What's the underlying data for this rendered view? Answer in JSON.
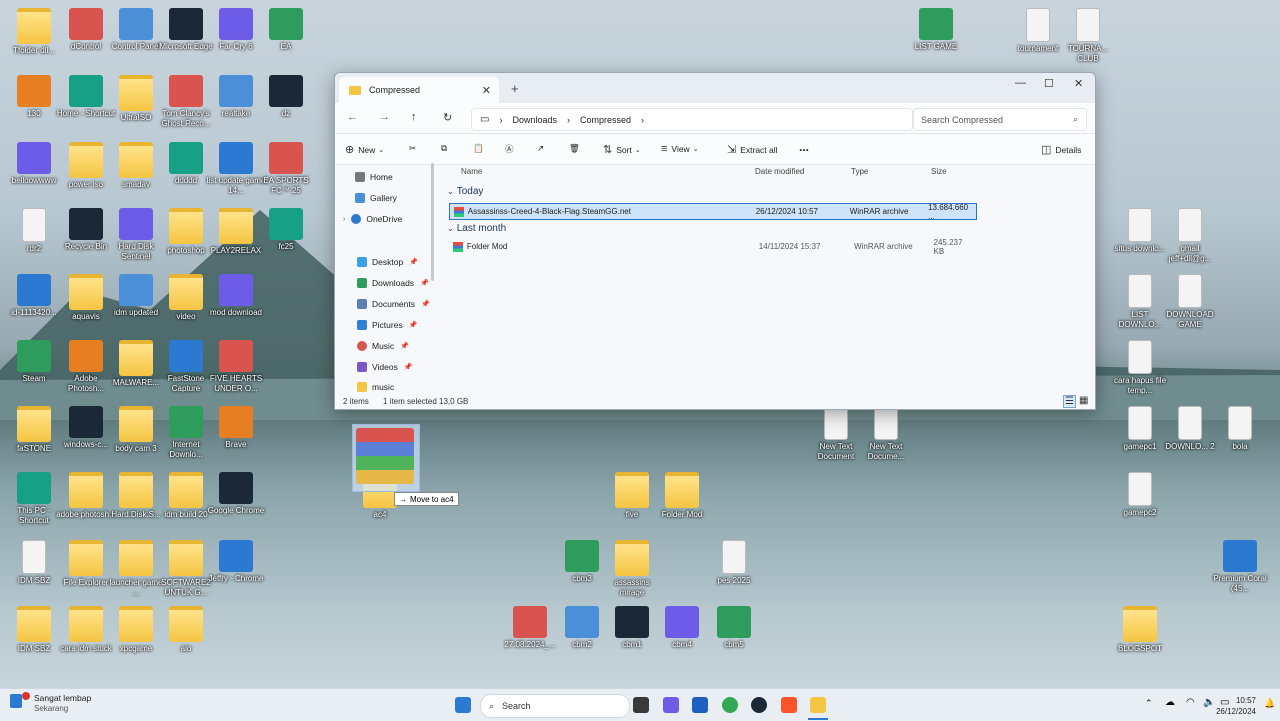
{
  "desktop": {
    "icons": [
      {
        "label": "Tfolder dll...",
        "kind": "folder"
      },
      {
        "label": "dControl",
        "kind": "app"
      },
      {
        "label": "Control Panel",
        "kind": "app"
      },
      {
        "label": "Microsoft Edge",
        "kind": "app"
      },
      {
        "label": "Far Cry 6",
        "kind": "app"
      },
      {
        "label": "EA",
        "kind": "app"
      },
      {
        "label": "130",
        "kind": "app"
      },
      {
        "label": "Home - Shortcut",
        "kind": "app"
      },
      {
        "label": "UltraISO",
        "kind": "folder"
      },
      {
        "label": "Tom Clancy's Ghost Reco...",
        "kind": "app"
      },
      {
        "label": "realtake",
        "kind": "app"
      },
      {
        "label": "dz",
        "kind": "app"
      },
      {
        "label": "belloowwww",
        "kind": "app"
      },
      {
        "label": "power iso",
        "kind": "folder"
      },
      {
        "label": "smadav",
        "kind": "folder"
      },
      {
        "label": "ddddd",
        "kind": "app"
      },
      {
        "label": "list update game 14...",
        "kind": "app"
      },
      {
        "label": "EA SPORTS FC™ 25",
        "kind": "app"
      },
      {
        "label": "rdr2",
        "kind": "doc"
      },
      {
        "label": "Recycle Bin",
        "kind": "app"
      },
      {
        "label": "Hard Disk Sentinel",
        "kind": "app"
      },
      {
        "label": "photoshop",
        "kind": "folder"
      },
      {
        "label": "PLAY2RELAX",
        "kind": "folder"
      },
      {
        "label": "fc25",
        "kind": "app"
      },
      {
        "label": "id-1113420...",
        "kind": "app"
      },
      {
        "label": "aquavis",
        "kind": "folder"
      },
      {
        "label": "idm updated",
        "kind": "app"
      },
      {
        "label": "video",
        "kind": "folder"
      },
      {
        "label": "mod download",
        "kind": "app"
      },
      {
        "label": "Steam",
        "kind": "app"
      },
      {
        "label": "Adobe Photosh...",
        "kind": "app"
      },
      {
        "label": "MALWARE...",
        "kind": "folder"
      },
      {
        "label": "FastStone Capture",
        "kind": "app"
      },
      {
        "label": "FIVE HEARTS UNDER O...",
        "kind": "app"
      },
      {
        "label": "faSTONE",
        "kind": "folder"
      },
      {
        "label": "windows-c...",
        "kind": "app"
      },
      {
        "label": "body cam 3",
        "kind": "folder"
      },
      {
        "label": "Internet Downlo...",
        "kind": "app"
      },
      {
        "label": "Brave",
        "kind": "app"
      },
      {
        "label": "This PC - Shortcut",
        "kind": "app"
      },
      {
        "label": "adobe photosh...",
        "kind": "folder"
      },
      {
        "label": "Hard.Disk.S...",
        "kind": "folder"
      },
      {
        "label": "idm build 20",
        "kind": "folder"
      },
      {
        "label": "Google Chrome",
        "kind": "app"
      },
      {
        "label": "IDM SBZ",
        "kind": "doc"
      },
      {
        "label": "File Explorer",
        "kind": "folder"
      },
      {
        "label": "launcher game ...",
        "kind": "folder"
      },
      {
        "label": "SOFTWARE2 UNTUK G...",
        "kind": "folder"
      },
      {
        "label": "Jeffry - Chrome",
        "kind": "app"
      },
      {
        "label": "IDM SBZ",
        "kind": "folder"
      },
      {
        "label": "cara idm stuck",
        "kind": "folder"
      },
      {
        "label": "xpcgame",
        "kind": "folder"
      },
      {
        "label": "aio",
        "kind": "folder"
      },
      {
        "label": "LIST GAME",
        "kind": "app"
      },
      {
        "label": "tournament",
        "kind": "doc"
      },
      {
        "label": "TOURNA... CLUB",
        "kind": "doc"
      },
      {
        "label": "situs downlo...",
        "kind": "doc"
      },
      {
        "label": "gmail jeff+dll@g...",
        "kind": "doc"
      },
      {
        "label": "LIST DOWNLO...",
        "kind": "doc"
      },
      {
        "label": "DOWNLOAD GAME",
        "kind": "doc"
      },
      {
        "label": "cara hapus file temp...",
        "kind": "doc"
      },
      {
        "label": "New Text Document",
        "kind": "doc"
      },
      {
        "label": "New Text Docume...",
        "kind": "doc"
      },
      {
        "label": "gamepc1",
        "kind": "doc"
      },
      {
        "label": "DOWNLO... 2",
        "kind": "doc"
      },
      {
        "label": "bola",
        "kind": "doc"
      },
      {
        "label": "five",
        "kind": "folder"
      },
      {
        "label": "Folder Mod",
        "kind": "folder"
      },
      {
        "label": "gamepc2",
        "kind": "doc"
      },
      {
        "label": "cbm3",
        "kind": "app"
      },
      {
        "label": "assassins mirage",
        "kind": "folder"
      },
      {
        "label": "pes 2025",
        "kind": "doc"
      },
      {
        "label": "Premium Coral (45...",
        "kind": "app"
      },
      {
        "label": "27.08.2024_...",
        "kind": "app"
      },
      {
        "label": "cbm2",
        "kind": "app"
      },
      {
        "label": "cbm1",
        "kind": "app"
      },
      {
        "label": "cbm4",
        "kind": "app"
      },
      {
        "label": "cbm5",
        "kind": "app"
      },
      {
        "label": "BLOGSPOT",
        "kind": "folder"
      },
      {
        "label": "ac4",
        "kind": "folder"
      }
    ]
  },
  "explorer": {
    "tab_title": "Compressed",
    "breadcrumb": [
      "Downloads",
      "Compressed"
    ],
    "search_placeholder": "Search Compressed",
    "toolbar": {
      "new": "New",
      "sort": "Sort",
      "view": "View",
      "extract": "Extract all",
      "more": "...",
      "details": "Details"
    },
    "sidebar": [
      {
        "label": "Home",
        "pinned": false
      },
      {
        "label": "Gallery",
        "pinned": false
      },
      {
        "label": "OneDrive",
        "pinned": false
      },
      {
        "label": "Desktop",
        "pinned": true
      },
      {
        "label": "Downloads",
        "pinned": true
      },
      {
        "label": "Documents",
        "pinned": true
      },
      {
        "label": "Pictures",
        "pinned": true
      },
      {
        "label": "Music",
        "pinned": true
      },
      {
        "label": "Videos",
        "pinned": true
      },
      {
        "label": "music",
        "pinned": false
      }
    ],
    "columns": [
      "Name",
      "Date modified",
      "Type",
      "Size"
    ],
    "groups": [
      {
        "title": "Today",
        "rows": [
          {
            "name": "Assassinss-Creed-4-Black-Flag.SteamGG.net",
            "date": "26/12/2024 10:57",
            "type": "WinRAR archive",
            "size": "13.684.660 ...",
            "selected": true
          }
        ]
      },
      {
        "title": "Last month",
        "rows": [
          {
            "name": "Folder Mod",
            "date": "14/11/2024 15:37",
            "type": "WinRAR archive",
            "size": "245.237 KB",
            "selected": false
          }
        ]
      }
    ],
    "status": {
      "items": "2 items",
      "selected": "1 item selected  13,0 GB"
    }
  },
  "drag": {
    "tooltip": "Move to ac4"
  },
  "taskbar": {
    "notification_title": "Sangat lembap",
    "notification_sub": "Sekarang",
    "search_label": "Search",
    "time": "10:57",
    "date": "26/12/2024"
  }
}
